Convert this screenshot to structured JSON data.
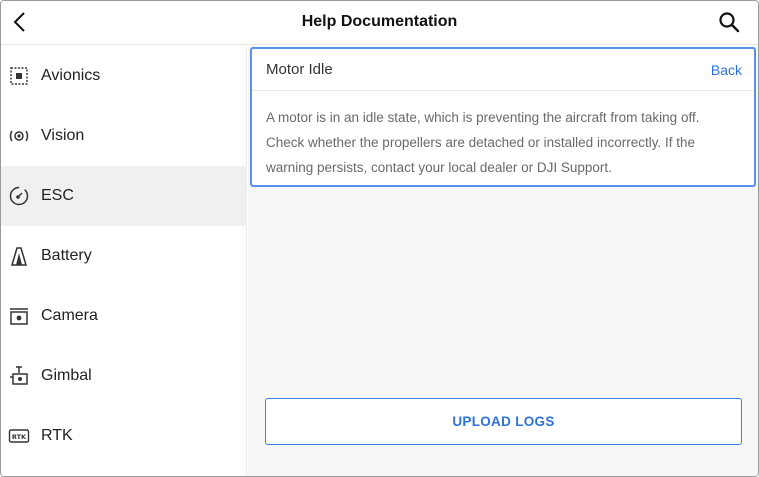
{
  "header": {
    "title": "Help Documentation",
    "back_icon": "chevron-left-icon",
    "search_icon": "search-icon"
  },
  "sidebar": {
    "active_index": 2,
    "items": [
      {
        "label": "Avionics",
        "icon": "avionics-icon"
      },
      {
        "label": "Vision",
        "icon": "vision-icon"
      },
      {
        "label": "ESC",
        "icon": "esc-icon"
      },
      {
        "label": "Battery",
        "icon": "battery-icon"
      },
      {
        "label": "Camera",
        "icon": "camera-icon"
      },
      {
        "label": "Gimbal",
        "icon": "gimbal-icon"
      },
      {
        "label": "RTK",
        "icon": "rtk-icon"
      }
    ]
  },
  "detail": {
    "title": "Motor Idle",
    "back_label": "Back",
    "description": "A motor is in an idle state, which is preventing the aircraft from taking off. Check whether the propellers are detached or installed incorrectly. If the warning persists, contact your local dealer or DJI Support."
  },
  "actions": {
    "upload_label": "UPLOAD LOGS"
  },
  "colors": {
    "accent": "#2f73d8",
    "card_border": "#5b8ff0",
    "active_bg": "#f0f0f0"
  }
}
